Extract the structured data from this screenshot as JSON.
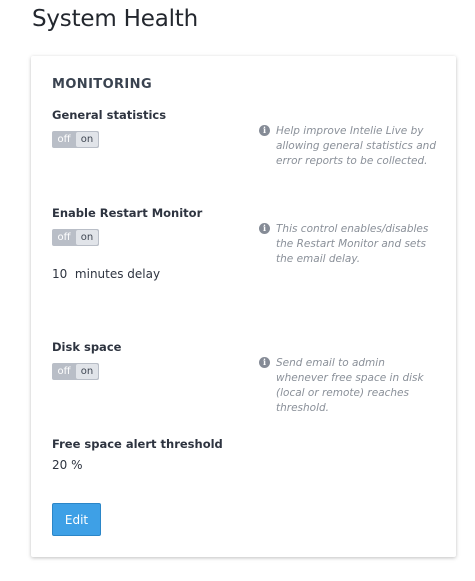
{
  "page": {
    "title": "System Health"
  },
  "monitoring": {
    "section_title": "MONITORING",
    "general_statistics": {
      "label": "General statistics",
      "toggle": {
        "off_label": "off",
        "on_label": "on",
        "state": "on"
      },
      "help": "Help improve Intelie Live by allowing general statistics and error reports to be collected."
    },
    "restart_monitor": {
      "label": "Enable Restart Monitor",
      "toggle": {
        "off_label": "off",
        "on_label": "on",
        "state": "on"
      },
      "help": "This control enables/disables the Restart Monitor and sets the email delay.",
      "delay_value": "10",
      "delay_unit": "minutes delay"
    },
    "disk_space": {
      "label": "Disk space",
      "toggle": {
        "off_label": "off",
        "on_label": "on",
        "state": "on"
      },
      "help": "Send email to admin whenever free space in disk (local or remote) reaches threshold."
    },
    "threshold": {
      "label": "Free space alert threshold",
      "value": "20 %"
    },
    "edit_label": "Edit"
  },
  "icons": {
    "help": "info-icon"
  },
  "colors": {
    "accent": "#3ea0e6",
    "toggle_bg": "#b9bec7",
    "help_text": "#8a9099"
  }
}
